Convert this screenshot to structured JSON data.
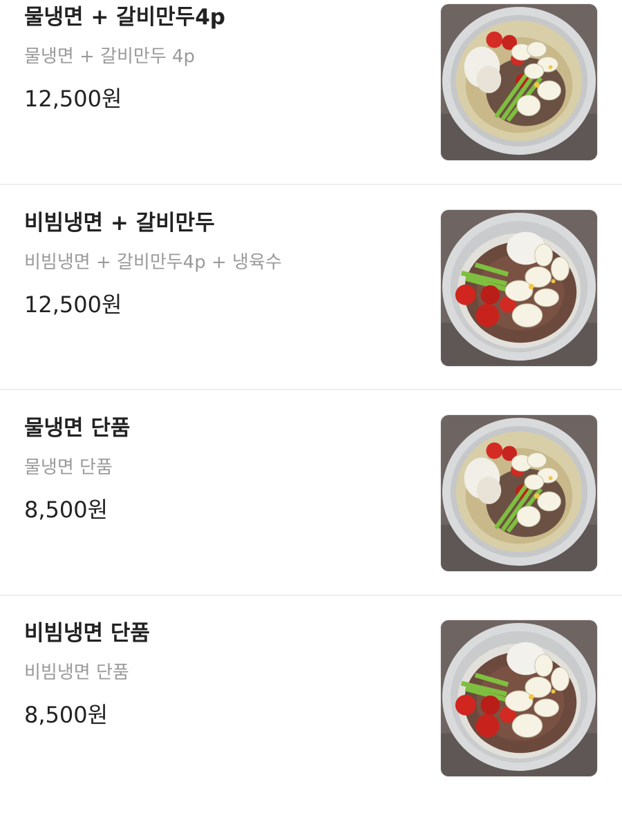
{
  "menu_items": [
    {
      "name": "물냉면 + 갈비만두4p",
      "description": "물냉면 + 갈비만두 4p",
      "price": "12,500원",
      "image_icon": "mul-naengmyeon-photo"
    },
    {
      "name": "비빔냉면 + 갈비만두",
      "description": "비빔냉면 + 갈비만두4p + 냉육수",
      "price": "12,500원",
      "image_icon": "bibim-naengmyeon-photo"
    },
    {
      "name": "물냉면 단품",
      "description": "물냉면 단품",
      "price": "8,500원",
      "image_icon": "mul-naengmyeon-photo"
    },
    {
      "name": "비빔냉면 단품",
      "description": "비빔냉면 단품",
      "price": "8,500원",
      "image_icon": "bibim-naengmyeon-photo"
    }
  ],
  "colors": {
    "title": "#222222",
    "description": "#9a9a9a",
    "divider": "#eeeeee",
    "photo_background": "#6b625f"
  }
}
